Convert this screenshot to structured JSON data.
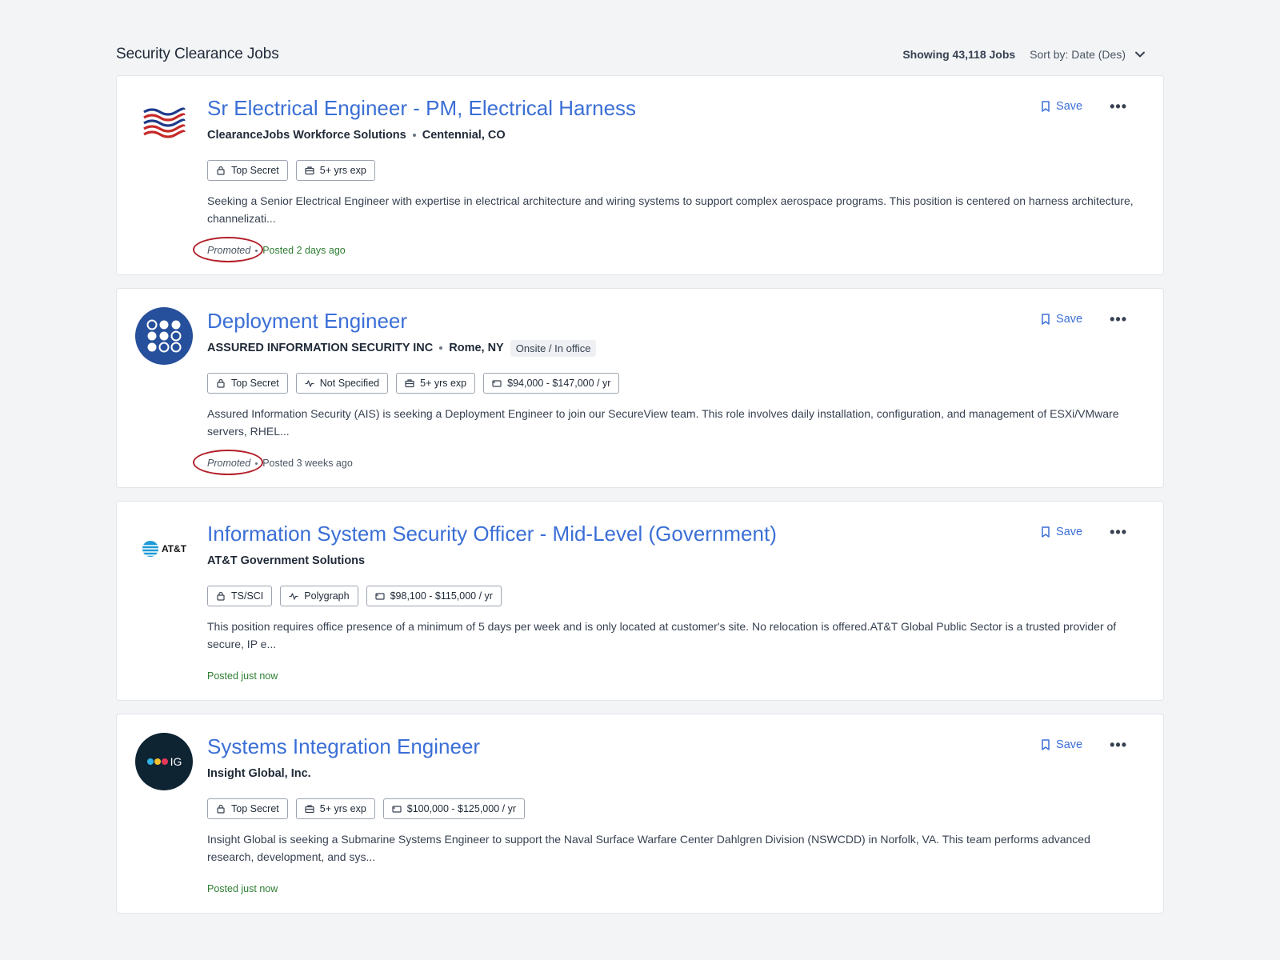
{
  "header": {
    "title": "Security Clearance Jobs",
    "showing": "Showing 43,118 Jobs",
    "sort": "Sort by: Date (Des)"
  },
  "actions": {
    "save_label": "Save",
    "more_label": "•••"
  },
  "jobs": [
    {
      "title": "Sr Electrical Engineer - PM, Electrical Harness",
      "company": "ClearanceJobs Workforce Solutions",
      "location": "Centennial, CO",
      "tags": [
        "Top Secret",
        "5+ yrs exp"
      ],
      "description": "Seeking a Senior Electrical Engineer with expertise in electrical architecture and wiring systems to support complex aerospace programs. This position is centered on harness architecture, channelizati...",
      "promoted": "Promoted",
      "posted": "Posted 2 days ago"
    },
    {
      "title": "Deployment Engineer",
      "company": "ASSURED INFORMATION SECURITY INC",
      "location": "Rome, NY",
      "workplace": "Onsite / In office",
      "tags": [
        "Top Secret",
        "Not Specified",
        "5+ yrs exp",
        "$94,000 - $147,000 / yr"
      ],
      "description": "Assured Information Security (AIS) is seeking a Deployment Engineer to join our SecureView team.  This role involves daily installation, configuration, and management of ESXi/VMware servers, RHEL...",
      "promoted": "Promoted",
      "posted": "Posted 3 weeks ago"
    },
    {
      "title": "Information System Security Officer - Mid-Level (Government)",
      "company": "AT&T Government Solutions",
      "logo_text": "AT&T",
      "tags": [
        "TS/SCI",
        "Polygraph",
        "$98,100 - $115,000 / yr"
      ],
      "description": "This position requires office presence of a minimum of 5 days per week and is only located at customer's site. No relocation is offered.AT&T Global Public Sector is a trusted provider of secure, IP e...",
      "posted": "Posted just now"
    },
    {
      "title": "Systems Integration Engineer",
      "company": "Insight Global, Inc.",
      "logo_text": "IG",
      "tags": [
        "Top Secret",
        "5+ yrs exp",
        "$100,000 - $125,000 / yr"
      ],
      "description": "Insight Global is seeking a Submarine Systems Engineer to support the Naval Surface Warfare Center Dahlgren Division (NSWCDD) in Norfolk, VA. This team performs advanced research, development, and sys...",
      "posted": "Posted just now"
    }
  ],
  "colors": {
    "link_blue": "#3b6fd6",
    "posted_green": "#2e7d32",
    "promoted_ring": "#b3202a"
  }
}
